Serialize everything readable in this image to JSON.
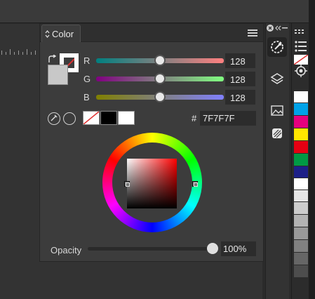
{
  "panel": {
    "tab_label": "Color",
    "tab_icon": "up-down-chevron-icon",
    "menu_icon": "hamburger-menu-icon"
  },
  "swatches": {
    "fill_color": "#c8c8c8",
    "stroke_color": "#ffffff"
  },
  "sliders": [
    {
      "label": "R",
      "value": "128",
      "fraction": 0.5,
      "gradient_from": "#008080",
      "gradient_to": "#ff8080"
    },
    {
      "label": "G",
      "value": "128",
      "fraction": 0.5,
      "gradient_from": "#800080",
      "gradient_to": "#80ff80"
    },
    {
      "label": "B",
      "value": "128",
      "fraction": 0.5,
      "gradient_from": "#808000",
      "gradient_to": "#8080ff"
    }
  ],
  "tools": {
    "eyedropper_icon": "eyedropper-icon",
    "no_color_icon": "empty-circle-icon"
  },
  "recent_swatches": [
    "none",
    "#000000",
    "#ffffff"
  ],
  "hex": {
    "hash": "#",
    "value": "7F7F7F"
  },
  "opacity": {
    "label": "Opacity",
    "value": "100%",
    "fraction": 1.0
  },
  "right_tools": [
    "color-picker-icon",
    "layers-icon",
    "image-icon",
    "styles-icon"
  ],
  "palette_colors": [
    "none",
    "#ffffff",
    "#00a2e8",
    "#e6007e",
    "#ffe600",
    "#e60012",
    "#009944",
    "#1d2088",
    "#ffffff",
    "#e6e6e6",
    "#cccccc",
    "#b3b3b3",
    "#999999",
    "#808080",
    "#666666",
    "#4d4d4d"
  ]
}
